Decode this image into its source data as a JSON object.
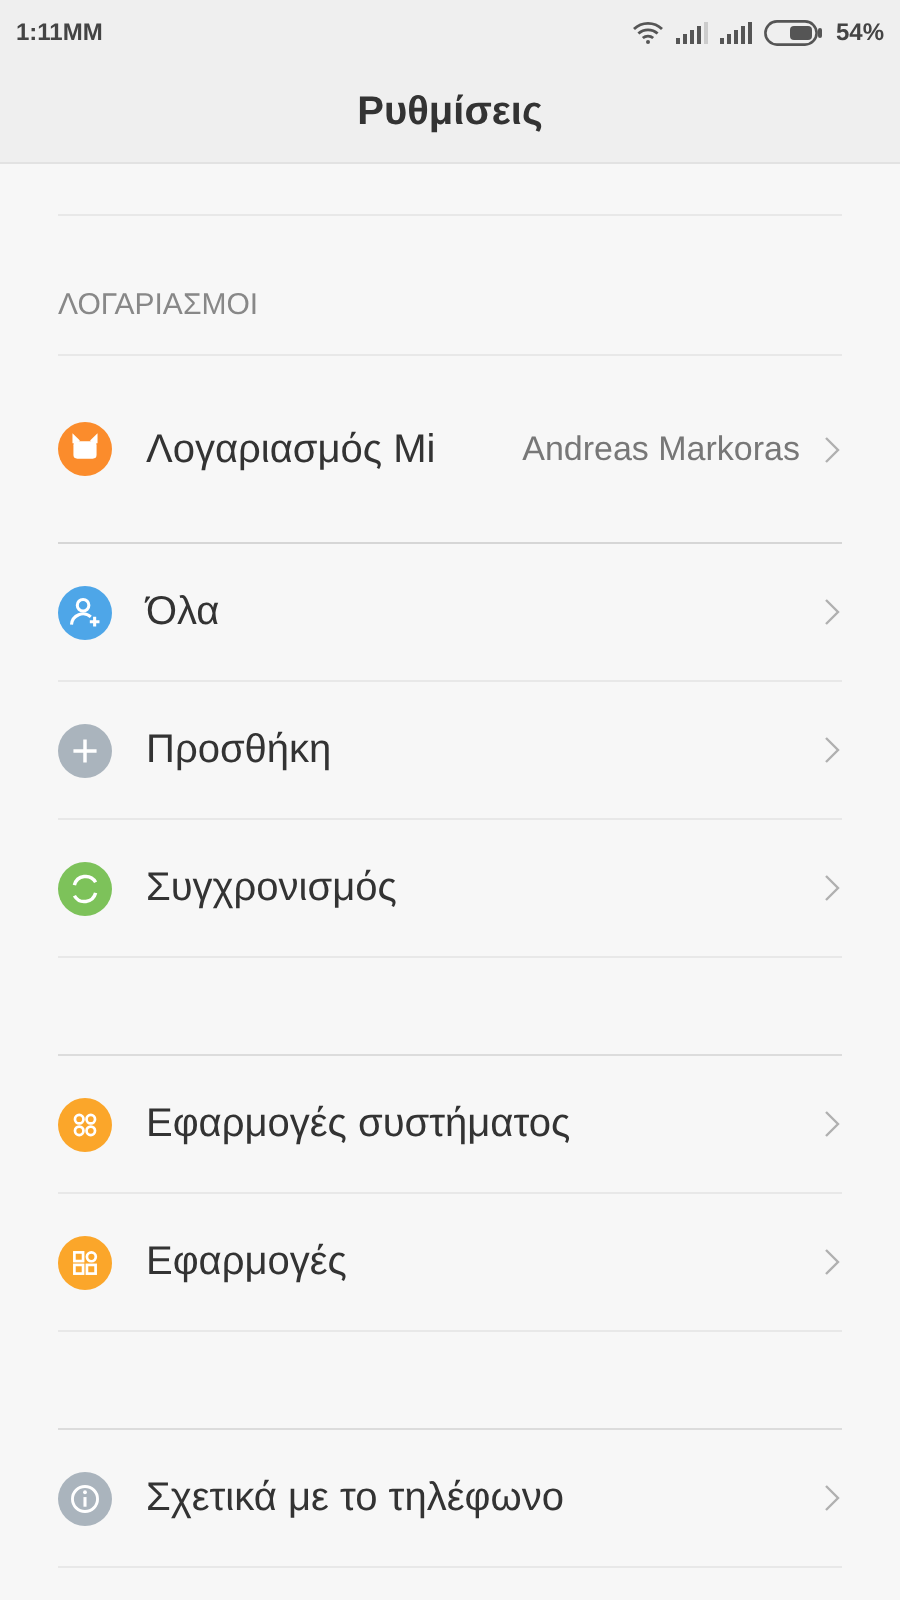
{
  "status_bar": {
    "time": "1:11MM",
    "battery_text": "54%"
  },
  "title": "Ρυθμίσεις",
  "groups": [
    {
      "header": "ΛΟΓΑΡΙΑΣΜΟΙ",
      "items": [
        {
          "kind": "mi",
          "color": "#fb8c2c",
          "label": "Λογαριασμός Mi",
          "value": "Andreas Markoras"
        },
        {
          "kind": "user",
          "color": "#4ea6e8",
          "label": "Όλα"
        },
        {
          "kind": "add",
          "color": "#aab4bd",
          "label": "Προσθήκη"
        },
        {
          "kind": "sync",
          "color": "#7dc25a",
          "label": "Συγχρονισμός"
        }
      ]
    },
    {
      "items": [
        {
          "kind": "apps",
          "color": "#fba62a",
          "label": "Εφαρμογές συστήματος"
        },
        {
          "kind": "grid",
          "color": "#fba62a",
          "label": "Εφαρμογές"
        }
      ]
    },
    {
      "items": [
        {
          "kind": "info",
          "color": "#aab4bd",
          "label": "Σχετικά με το τηλέφωνο"
        }
      ]
    }
  ]
}
